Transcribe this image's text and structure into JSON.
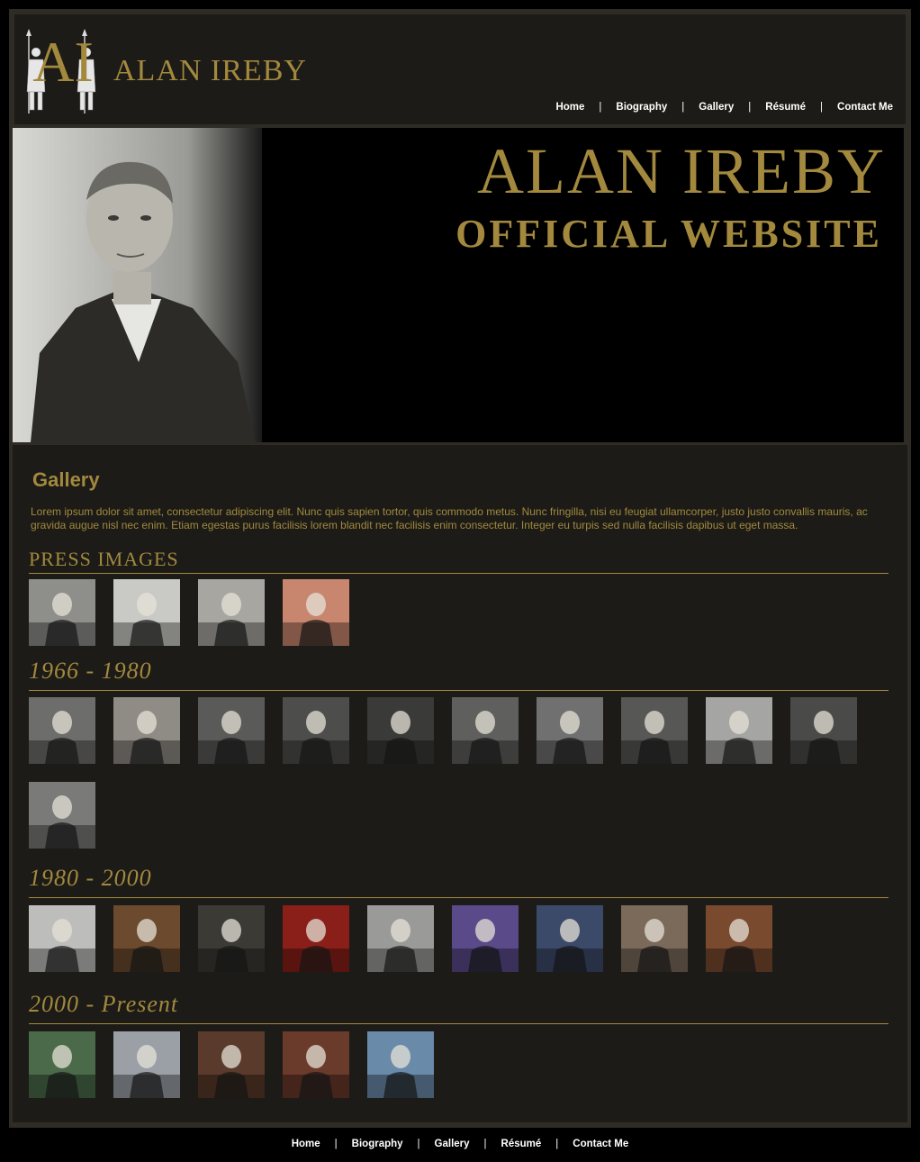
{
  "logo": {
    "text": "ALAN IREBY",
    "monogram": "AI"
  },
  "nav": [
    "Home",
    "Biography",
    "Gallery",
    "Résumé",
    "Contact Me"
  ],
  "banner": {
    "title": "ALAN IREBY",
    "subtitle": "OFFICIAL WEBSITE"
  },
  "page": {
    "title": "Gallery",
    "intro": "Lorem ipsum dolor sit amet, consectetur adipiscing elit. Nunc quis sapien tortor, quis commodo metus. Nunc fringilla, nisi eu feugiat ullamcorper, justo justo convallis mauris, ac gravida augue nisl nec enim. Etiam egestas purus facilisis lorem blandit nec facilisis enim consectetur. Integer eu turpis sed nulla facilisis dapibus ut eget massa."
  },
  "sections": [
    {
      "title": "PRESS IMAGES",
      "style": "caps",
      "thumb_count": 4
    },
    {
      "title": "1966 - 1980",
      "style": "script",
      "thumb_count": 11
    },
    {
      "title": "1980 - 2000",
      "style": "script",
      "thumb_count": 9
    },
    {
      "title": "2000 - Present",
      "style": "script",
      "thumb_count": 5
    }
  ],
  "footer_nav": [
    "Home",
    "Biography",
    "Gallery",
    "Résumé",
    "Contact Me"
  ],
  "colors": {
    "gold": "#a3893e",
    "background": "#1c1b17",
    "frame": "#2e2c24"
  }
}
